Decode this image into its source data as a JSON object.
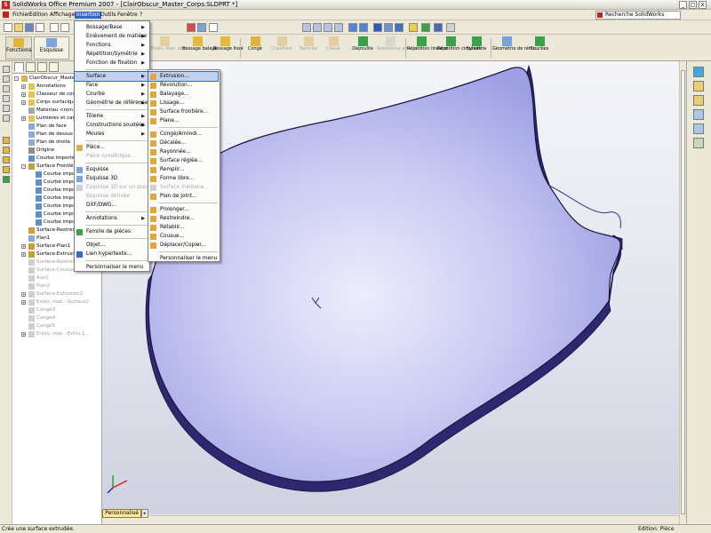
{
  "window": {
    "title": "SolidWorks Office Premium 2007 - [ClairObscur_Master_Corps.SLDPRT *]",
    "logo_letter": "S",
    "win_buttons": [
      "_",
      "□",
      "x"
    ]
  },
  "menubar": {
    "items": [
      "Fichier",
      "Edition",
      "Affichage",
      "Insertion",
      "Outils",
      "Fenêtre",
      "?"
    ],
    "search_label": "Recherche SolidWorks"
  },
  "command_manager": {
    "tabs": [
      "Fonctions",
      "Esquisse"
    ],
    "buttons": [
      {
        "label": "Enlèv. mat. avec...",
        "enabled": false
      },
      {
        "label": "Bossage balayé",
        "enabled": true
      },
      {
        "label": "Bossage lissé",
        "enabled": true
      },
      {
        "label": "Congé",
        "enabled": true
      },
      {
        "label": "Chanfrein",
        "enabled": false
      },
      {
        "label": "Nervure",
        "enabled": false
      },
      {
        "label": "Coque",
        "enabled": false
      },
      {
        "label": "Dépouille",
        "enabled": true
      },
      {
        "label": "Assistance pour le...",
        "enabled": false
      },
      {
        "label": "Répétition linéaire",
        "enabled": true
      },
      {
        "label": "Répétition circulaire",
        "enabled": true
      },
      {
        "label": "Symétrie",
        "enabled": true
      },
      {
        "label": "Géométrie de référ...",
        "enabled": true
      },
      {
        "label": "Courbes",
        "enabled": true
      }
    ]
  },
  "feature_tree": {
    "items": [
      {
        "label": "ClairObscur_Master_C...",
        "indent": 0,
        "expander": "-",
        "greyed": false,
        "icon": "part-icon"
      },
      {
        "label": "Annotations",
        "indent": 1,
        "expander": "+",
        "greyed": false,
        "icon": "annotations-icon"
      },
      {
        "label": "Classeur de concep...",
        "indent": 1,
        "expander": "+",
        "greyed": false,
        "icon": "design-binder-icon"
      },
      {
        "label": "Corps surfaciques(...",
        "indent": 1,
        "expander": "+",
        "greyed": false,
        "icon": "surface-bodies-icon"
      },
      {
        "label": "Matériau <non spé...",
        "indent": 1,
        "expander": "",
        "greyed": false,
        "icon": "material-icon"
      },
      {
        "label": "Lumières et camér...",
        "indent": 1,
        "expander": "+",
        "greyed": false,
        "icon": "lights-icon"
      },
      {
        "label": "Plan de face",
        "indent": 1,
        "expander": "",
        "greyed": false,
        "icon": "plane-icon"
      },
      {
        "label": "Plan de dessus",
        "indent": 1,
        "expander": "",
        "greyed": false,
        "icon": "plane-icon"
      },
      {
        "label": "Plan de droite",
        "indent": 1,
        "expander": "",
        "greyed": false,
        "icon": "plane-icon"
      },
      {
        "label": "Origine",
        "indent": 1,
        "expander": "",
        "greyed": false,
        "icon": "origin-icon"
      },
      {
        "label": "Courbe importée7",
        "indent": 1,
        "expander": "",
        "greyed": false,
        "icon": "curve-icon"
      },
      {
        "label": "Surface Frontière1",
        "indent": 1,
        "expander": "-",
        "greyed": false,
        "icon": "boundary-surface-icon"
      },
      {
        "label": "Courbe importé...",
        "indent": 2,
        "expander": "",
        "greyed": false,
        "icon": "curve-icon"
      },
      {
        "label": "Courbe importé...",
        "indent": 2,
        "expander": "",
        "greyed": false,
        "icon": "curve-icon"
      },
      {
        "label": "Courbe importé...",
        "indent": 2,
        "expander": "",
        "greyed": false,
        "icon": "curve-icon"
      },
      {
        "label": "Courbe importé...",
        "indent": 2,
        "expander": "",
        "greyed": false,
        "icon": "curve-icon"
      },
      {
        "label": "Courbe importé...",
        "indent": 2,
        "expander": "",
        "greyed": false,
        "icon": "curve-icon"
      },
      {
        "label": "Courbe importé...",
        "indent": 2,
        "expander": "",
        "greyed": false,
        "icon": "curve-icon"
      },
      {
        "label": "Courbe importé...",
        "indent": 2,
        "expander": "",
        "greyed": false,
        "icon": "curve-icon"
      },
      {
        "label": "Surface-Restreindr...",
        "indent": 1,
        "expander": "",
        "greyed": false,
        "icon": "trim-surface-icon"
      },
      {
        "label": "Plan1",
        "indent": 1,
        "expander": "",
        "greyed": false,
        "icon": "plane-icon"
      },
      {
        "label": "Surface-Plan1",
        "indent": 1,
        "expander": "+",
        "greyed": false,
        "icon": "planar-surface-icon"
      },
      {
        "label": "Surface-Extrusion1",
        "indent": 1,
        "expander": "+",
        "greyed": false,
        "icon": "extruded-surface-icon"
      },
      {
        "label": "Surface-Restreindr...",
        "indent": 1,
        "expander": "",
        "greyed": true,
        "icon": "trim-surface-icon"
      },
      {
        "label": "Surface-Cousue1",
        "indent": 1,
        "expander": "",
        "greyed": true,
        "icon": "knit-surface-icon"
      },
      {
        "label": "Axe1",
        "indent": 1,
        "expander": "",
        "greyed": true,
        "icon": "axis-icon"
      },
      {
        "label": "Plan2",
        "indent": 1,
        "expander": "",
        "greyed": true,
        "icon": "plane-icon"
      },
      {
        "label": "Surface-Extrusion2",
        "indent": 1,
        "expander": "+",
        "greyed": true,
        "icon": "extruded-surface-icon"
      },
      {
        "label": "Enlèv. mat. -Surface2",
        "indent": 1,
        "expander": "+",
        "greyed": true,
        "icon": "cut-icon"
      },
      {
        "label": "Congé3",
        "indent": 1,
        "expander": "",
        "greyed": true,
        "icon": "fillet-icon"
      },
      {
        "label": "Congé4",
        "indent": 1,
        "expander": "",
        "greyed": true,
        "icon": "fillet-icon"
      },
      {
        "label": "Congé5",
        "indent": 1,
        "expander": "",
        "greyed": true,
        "icon": "fillet-icon"
      },
      {
        "label": "Enlèv. mat. -Extru.1...",
        "indent": 1,
        "expander": "+",
        "greyed": true,
        "icon": "cut-icon"
      }
    ]
  },
  "insertion_menu": {
    "items": [
      {
        "label": "Bossage/Base",
        "submenu": true,
        "enabled": true,
        "icon": ""
      },
      {
        "label": "Enlèvement de matière",
        "submenu": true,
        "enabled": true,
        "icon": ""
      },
      {
        "label": "Fonctions",
        "submenu": true,
        "enabled": true,
        "icon": ""
      },
      {
        "label": "Répétition/Symétrie",
        "submenu": true,
        "enabled": true,
        "icon": ""
      },
      {
        "label": "Fonction de fixation",
        "submenu": true,
        "enabled": true,
        "icon": ""
      },
      {
        "sep": true
      },
      {
        "label": "Surface",
        "submenu": true,
        "enabled": true,
        "icon": "",
        "highlight": true
      },
      {
        "label": "Face",
        "submenu": true,
        "enabled": true,
        "icon": ""
      },
      {
        "label": "Courbe",
        "submenu": true,
        "enabled": true,
        "icon": ""
      },
      {
        "label": "Géométrie de référence",
        "submenu": true,
        "enabled": true,
        "icon": ""
      },
      {
        "sep": true
      },
      {
        "label": "Tôlerie",
        "submenu": true,
        "enabled": true,
        "icon": ""
      },
      {
        "label": "Constructions soudées",
        "submenu": true,
        "enabled": true,
        "icon": ""
      },
      {
        "label": "Moules",
        "submenu": true,
        "enabled": true,
        "icon": ""
      },
      {
        "sep": true
      },
      {
        "label": "Pièce...",
        "submenu": false,
        "enabled": true,
        "icon": "part-icon"
      },
      {
        "label": "Pièce symétrique...",
        "submenu": false,
        "enabled": false,
        "icon": ""
      },
      {
        "sep": true
      },
      {
        "label": "Esquisse",
        "submenu": false,
        "enabled": true,
        "icon": "sketch-icon"
      },
      {
        "label": "Esquisse 3D",
        "submenu": false,
        "enabled": true,
        "icon": "sketch3d-icon"
      },
      {
        "label": "Esquisse 3D sur un plan",
        "submenu": false,
        "enabled": false,
        "icon": "sketch3d-plane-icon"
      },
      {
        "label": "Esquisse dérivée",
        "submenu": false,
        "enabled": false,
        "icon": ""
      },
      {
        "label": "DXF/DWG...",
        "submenu": false,
        "enabled": true,
        "icon": ""
      },
      {
        "sep": true
      },
      {
        "label": "Annotations",
        "submenu": true,
        "enabled": true,
        "icon": ""
      },
      {
        "sep": true
      },
      {
        "label": "Famille de pièces",
        "submenu": false,
        "enabled": true,
        "icon": "design-table-icon"
      },
      {
        "sep": true
      },
      {
        "label": "Objet...",
        "submenu": false,
        "enabled": true,
        "icon": ""
      },
      {
        "label": "Lien hypertexte...",
        "submenu": false,
        "enabled": true,
        "icon": "hyperlink-icon"
      },
      {
        "sep": true
      },
      {
        "label": "Personnaliser le menu",
        "submenu": false,
        "enabled": true,
        "icon": ""
      }
    ]
  },
  "surface_submenu": {
    "items": [
      {
        "label": "Extrusion...",
        "enabled": true,
        "highlight": true,
        "icon": "extruded-surface-icon"
      },
      {
        "label": "Révolution...",
        "enabled": true,
        "icon": "revolved-surface-icon"
      },
      {
        "label": "Balayage...",
        "enabled": true,
        "icon": "swept-surface-icon"
      },
      {
        "label": "Lissage...",
        "enabled": true,
        "icon": "lofted-surface-icon"
      },
      {
        "label": "Surface frontière...",
        "enabled": true,
        "icon": "boundary-surface-icon"
      },
      {
        "label": "Plane...",
        "enabled": true,
        "icon": "planar-surface-icon"
      },
      {
        "sep": true
      },
      {
        "label": "Congé/Arrondi...",
        "enabled": true,
        "icon": "fillet-icon"
      },
      {
        "label": "Décalée...",
        "enabled": true,
        "icon": "offset-surface-icon"
      },
      {
        "label": "Rayonnée...",
        "enabled": true,
        "icon": "radiate-surface-icon"
      },
      {
        "label": "Surface réglée...",
        "enabled": true,
        "icon": "ruled-surface-icon"
      },
      {
        "label": "Remplir...",
        "enabled": true,
        "icon": "fill-surface-icon"
      },
      {
        "label": "Forme libre...",
        "enabled": true,
        "icon": "freeform-icon"
      },
      {
        "label": "Surface médiane...",
        "enabled": false,
        "icon": "mid-surface-icon"
      },
      {
        "label": "Plan de joint...",
        "enabled": true,
        "icon": "parting-line-icon"
      },
      {
        "sep": true
      },
      {
        "label": "Prolonger...",
        "enabled": true,
        "icon": "extend-surface-icon"
      },
      {
        "label": "Restreindre...",
        "enabled": true,
        "icon": "trim-surface-icon"
      },
      {
        "label": "Rétablir...",
        "enabled": true,
        "icon": "untrim-surface-icon"
      },
      {
        "label": "Cousue...",
        "enabled": true,
        "icon": "knit-surface-icon"
      },
      {
        "label": "Déplacer/Copier...",
        "enabled": true,
        "icon": "move-copy-icon"
      },
      {
        "sep": true
      },
      {
        "label": "Personnaliser le menu",
        "enabled": true,
        "icon": ""
      }
    ]
  },
  "viewport": {
    "view_tab": "Personnalisé"
  },
  "statusbar": {
    "message": "Crée une surface extrudée.",
    "mode": "Edition: Pièce"
  },
  "colors": {
    "menu_highlight": "#316ac5",
    "model_face": "#c9caf2",
    "model_edge": "#2b2560"
  }
}
